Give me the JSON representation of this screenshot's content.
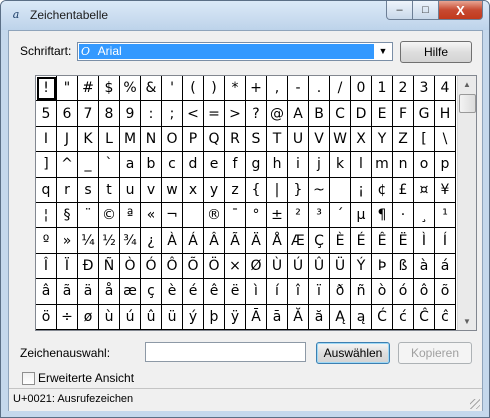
{
  "window": {
    "title": "Zeichentabelle",
    "app_icon": "font-a",
    "buttons": {
      "minimize": "–",
      "maximize": "□",
      "close": "X"
    }
  },
  "font": {
    "label": "Schriftart:",
    "selected": "Arial",
    "icon": "opentype-font-icon",
    "dropdown_icon": "chevron-down-icon"
  },
  "help_button": "Hilfe",
  "grid": {
    "rows": [
      [
        "!",
        "\"",
        "#",
        "$",
        "%",
        "&",
        "'",
        "(",
        ")",
        "*",
        "+",
        ",",
        "-",
        ".",
        "/",
        "0",
        "1",
        "2",
        "3",
        "4"
      ],
      [
        "5",
        "6",
        "7",
        "8",
        "9",
        ":",
        ";",
        "<",
        "=",
        ">",
        "?",
        "@",
        "A",
        "B",
        "C",
        "D",
        "E",
        "F",
        "G",
        "H"
      ],
      [
        "I",
        "J",
        "K",
        "L",
        "M",
        "N",
        "O",
        "P",
        "Q",
        "R",
        "S",
        "T",
        "U",
        "V",
        "W",
        "X",
        "Y",
        "Z",
        "[",
        "\\"
      ],
      [
        "]",
        "^",
        "_",
        "`",
        "a",
        "b",
        "c",
        "d",
        "e",
        "f",
        "g",
        "h",
        "i",
        "j",
        "k",
        "l",
        "m",
        "n",
        "o",
        "p"
      ],
      [
        "q",
        "r",
        "s",
        "t",
        "u",
        "v",
        "w",
        "x",
        "y",
        "z",
        "{",
        "|",
        "}",
        "~",
        " ",
        "¡",
        "¢",
        "£",
        "¤",
        "¥"
      ],
      [
        "¦",
        "§",
        "¨",
        "©",
        "ª",
        "«",
        "¬",
        "­",
        "®",
        "¯",
        "°",
        "±",
        "²",
        "³",
        "´",
        "µ",
        "¶",
        "·",
        "¸",
        "¹"
      ],
      [
        "º",
        "»",
        "¼",
        "½",
        "¾",
        "¿",
        "À",
        "Á",
        "Â",
        "Ã",
        "Ä",
        "Å",
        "Æ",
        "Ç",
        "È",
        "É",
        "Ê",
        "Ë",
        "Ì",
        "Í"
      ],
      [
        "Î",
        "Ï",
        "Ð",
        "Ñ",
        "Ò",
        "Ó",
        "Ô",
        "Õ",
        "Ö",
        "×",
        "Ø",
        "Ù",
        "Ú",
        "Û",
        "Ü",
        "Ý",
        "Þ",
        "ß",
        "à",
        "á"
      ],
      [
        "â",
        "ã",
        "ä",
        "å",
        "æ",
        "ç",
        "è",
        "é",
        "ê",
        "ë",
        "ì",
        "í",
        "î",
        "ï",
        "ð",
        "ñ",
        "ò",
        "ó",
        "ô",
        "õ"
      ],
      [
        "ö",
        "÷",
        "ø",
        "ù",
        "ú",
        "û",
        "ü",
        "ý",
        "þ",
        "ÿ",
        "Ā",
        "ā",
        "Ă",
        "ă",
        "Ą",
        "ą",
        "Ć",
        "ć",
        "Ĉ",
        "ĉ"
      ]
    ],
    "selected_char": "!"
  },
  "selection": {
    "label": "Zeichenauswahl:",
    "value": "",
    "select_button": "Auswählen",
    "copy_button": "Kopieren"
  },
  "advanced_view": {
    "label": "Erweiterte Ansicht",
    "checked": false
  },
  "status": "U+0021: Ausrufezeichen"
}
